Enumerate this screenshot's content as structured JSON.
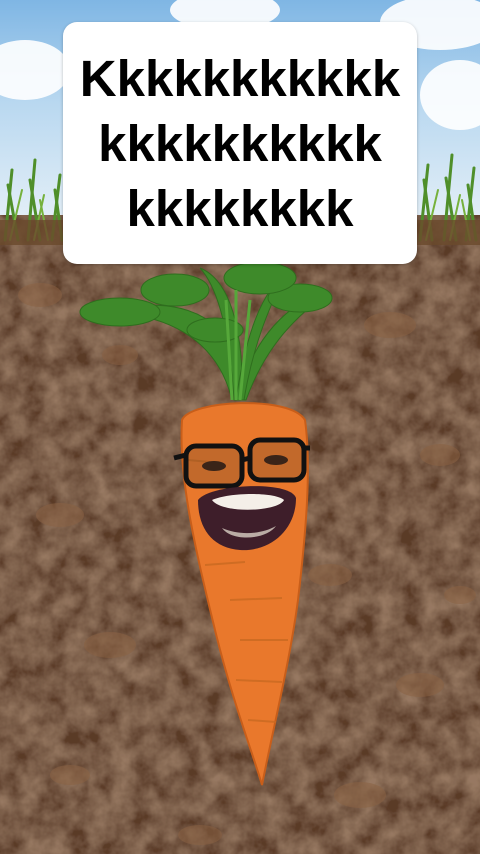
{
  "caption": {
    "line1": "Kkkkkkkkkkk",
    "line2": "kkkkkkkkkk",
    "line3": "kkkkkkkk"
  },
  "colors": {
    "sky": "#9cc8ec",
    "grass": "#4f8f2a",
    "soil": "#4a2e1f",
    "carrot": "#e9782c",
    "leaves": "#3e8a2a",
    "caption_bg": "#ffffff",
    "caption_text": "#000000"
  }
}
